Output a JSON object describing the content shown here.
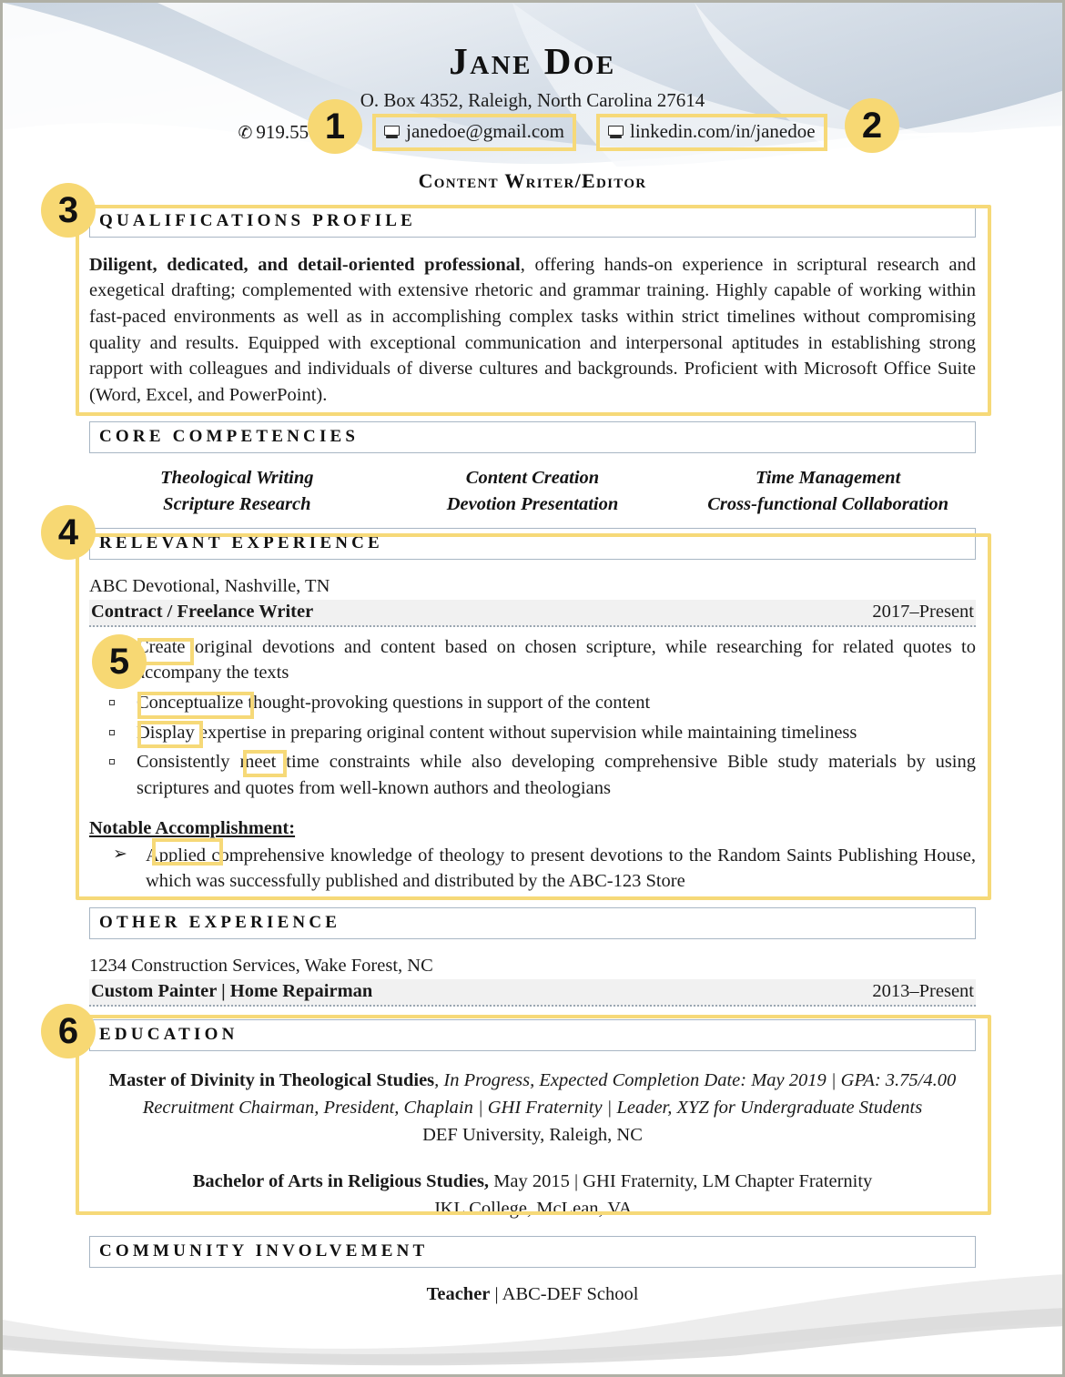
{
  "document": {
    "type": "resume",
    "name": "Jane Doe",
    "address": "O. Box 4352, Raleigh, North Carolina 27614",
    "phone": "919.55",
    "phone_icon": "pen-icon",
    "email": "janedoe@gmail.com",
    "linkedin": "linkedin.com/in/janedoe",
    "headline": "Content Writer/Editor"
  },
  "sections": {
    "qualifications": {
      "heading": "QUALIFICATIONS PROFILE",
      "lead": "Diligent, dedicated, and detail-oriented professional",
      "body": ", offering hands-on experience in scriptural research and exegetical drafting; complemented with extensive rhetoric and grammar training. Highly capable of working within fast-paced environments as well as in accomplishing complex tasks within strict timelines without compromising quality and results. Equipped with exceptional communication and interpersonal aptitudes in establishing strong rapport with colleagues and individuals of diverse cultures and backgrounds. Proficient with Microsoft Office Suite (Word, Excel, and PowerPoint)."
    },
    "competencies": {
      "heading": "CORE COMPETENCIES",
      "items": [
        "Theological Writing",
        "Content Creation",
        "Time Management",
        "Scripture Research",
        "Devotion Presentation",
        "Cross-functional Collaboration"
      ]
    },
    "relevant_experience": {
      "heading": "RELEVANT EXPERIENCE",
      "organization": "ABC Devotional, Nashville, TN",
      "position": "Contract / Freelance Writer",
      "dates": "2017–Present",
      "bullets": [
        "Create original devotions and content based on chosen scripture, while researching for related quotes to accompany the texts",
        "Conceptualize thought-provoking questions in support of the content",
        "Display expertise in preparing original content without supervision while maintaining timeliness",
        "Consistently meet time constraints while also developing comprehensive Bible study materials by using scriptures and quotes from well-known authors and theologians"
      ],
      "notable_label": "Notable Accomplishment:",
      "notable_items": [
        "Applied comprehensive knowledge of theology to present devotions to the Random Saints Publishing House, which was successfully published and distributed by the ABC-123 Store"
      ]
    },
    "other_experience": {
      "heading": "OTHER EXPERIENCE",
      "organization": "1234 Construction Services, Wake Forest, NC",
      "position": "Custom Painter | Home Repairman",
      "dates": "2013–Present"
    },
    "education": {
      "heading": "EDUCATION",
      "entries": [
        {
          "degree": "Master of Divinity in Theological Studies",
          "detail": ", In Progress, Expected Completion Date: May 2019 | GPA: 3.75/4.00",
          "activities": "Recruitment Chairman, President, Chaplain | GHI Fraternity | Leader, XYZ for Undergraduate Students",
          "school": "DEF University, Raleigh, NC"
        },
        {
          "degree": "Bachelor of Arts in Religious Studies,",
          "detail": " May 2015 | GHI Fraternity, LM Chapter Fraternity",
          "school": "JKL College, McLean, VA"
        }
      ]
    },
    "community": {
      "heading": "COMMUNITY INVOLVEMENT",
      "role": "Teacher",
      "separator": "|",
      "place": "ABC-DEF School"
    }
  },
  "annotations": {
    "accent_color": "#f7d873",
    "markers": [
      {
        "number": "1",
        "target": "email-chip"
      },
      {
        "number": "2",
        "target": "linkedin-chip"
      },
      {
        "number": "3",
        "target": "qualifications-section"
      },
      {
        "number": "4",
        "target": "relevant-experience-section"
      },
      {
        "number": "5",
        "target": "action-verbs"
      },
      {
        "number": "6",
        "target": "education-section"
      }
    ],
    "highlighted_verbs": [
      "Create",
      "Conceptualize",
      "Display",
      "meet",
      "Applied"
    ]
  }
}
